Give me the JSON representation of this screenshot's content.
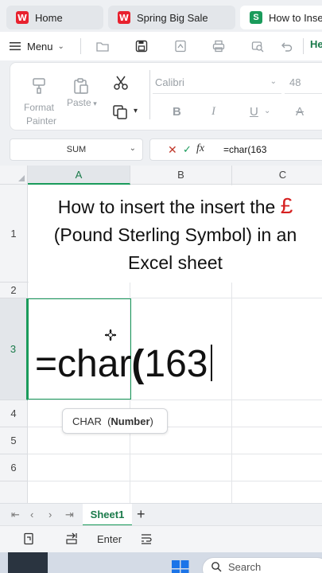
{
  "tabs": [
    {
      "label": "Home",
      "icon": "wps-logo-icon"
    },
    {
      "label": "Spring Big Sale",
      "icon": "wps-logo-icon"
    },
    {
      "label": "How to Insert",
      "icon": "spreadsheet-logo-icon"
    }
  ],
  "menubar": {
    "menu_label": "Menu",
    "next_tab_label": "He"
  },
  "ribbon": {
    "format_painter_line1": "Format",
    "format_painter_line2": "Painter",
    "paste_label": "Paste",
    "font_name": "Calibri",
    "font_size": "48",
    "bold": "B",
    "italic": "I",
    "underline": "U",
    "strike": "A"
  },
  "formula_bar": {
    "name_box": "SUM",
    "fx": "fx",
    "formula": "=char(163"
  },
  "grid": {
    "columns": [
      "A",
      "B",
      "C"
    ],
    "rows": [
      "1",
      "2",
      "3",
      "4",
      "5",
      "6"
    ],
    "title_line1": "How to insert the insert the",
    "title_pound": "£",
    "title_line2": "(Pound Sterling Symbol) in an",
    "title_line3": "Excel sheet",
    "formula_prefix": "=char",
    "formula_paren": "(",
    "formula_suffix": "163"
  },
  "tooltip": {
    "func": "CHAR",
    "arg_open": "(",
    "arg": "Number",
    "arg_close": ")"
  },
  "sheets": {
    "active": "Sheet1",
    "add": "+"
  },
  "actionbar": {
    "enter_label": "Enter"
  },
  "taskbar": {
    "search_label": "Search"
  },
  "colors": {
    "accent_green": "#1a9b5b",
    "brand_red": "#e8212e",
    "pound_red": "#d62020"
  }
}
